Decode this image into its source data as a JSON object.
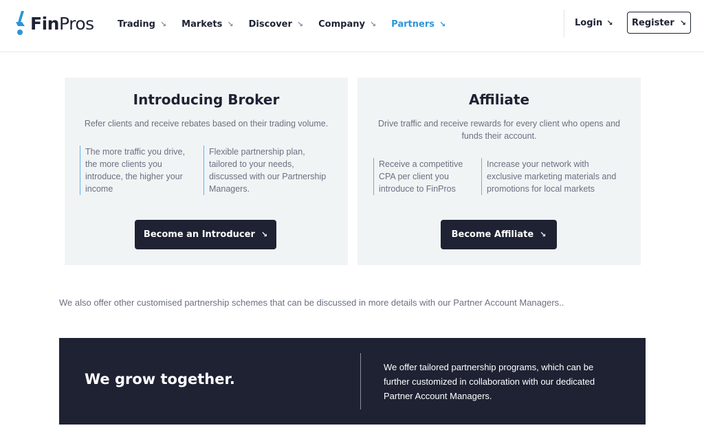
{
  "header": {
    "logo": {
      "brand_bold": "Fin",
      "brand_light": "Pros",
      "icon": "finpros-logo-icon",
      "accent": "#2a96d8"
    },
    "nav": [
      {
        "label": "Trading",
        "active": false
      },
      {
        "label": "Markets",
        "active": false
      },
      {
        "label": "Discover",
        "active": false
      },
      {
        "label": "Company",
        "active": false
      },
      {
        "label": "Partners",
        "active": true
      }
    ],
    "nav_arrow": "↘",
    "login_label": "Login",
    "register_label": "Register"
  },
  "cards": {
    "introducing_broker": {
      "title": "Introducing Broker",
      "subtitle": "Refer clients and receive rebates based on their trading volume.",
      "features": [
        "The more traffic you drive, the more clients you introduce, the higher your income",
        "Flexible partnership plan, tailored to your needs, discussed with our Partnership Managers."
      ],
      "cta_label": "Become an Introducer"
    },
    "affiliate": {
      "title": "Affiliate",
      "subtitle": "Drive traffic and receive rewards for every client who opens and funds their account.",
      "features": [
        "Receive a competitive CPA per client you introduce to FinPros",
        "Increase your network with exclusive marketing materials and promotions for local markets"
      ],
      "cta_label": "Become Affiliate"
    }
  },
  "offer_text": "We also offer other customised partnership schemes that can be discussed in more details with our Partner Account Managers..",
  "banner": {
    "title": "We grow together.",
    "text": "We offer tailored partnership programs, which can be further customized in collaboration with our dedicated Partner Account Managers."
  },
  "colors": {
    "dark": "#1e2233",
    "accent": "#2a96d8",
    "card_bg": "#f1f4f5",
    "muted_text": "#6b7080"
  }
}
